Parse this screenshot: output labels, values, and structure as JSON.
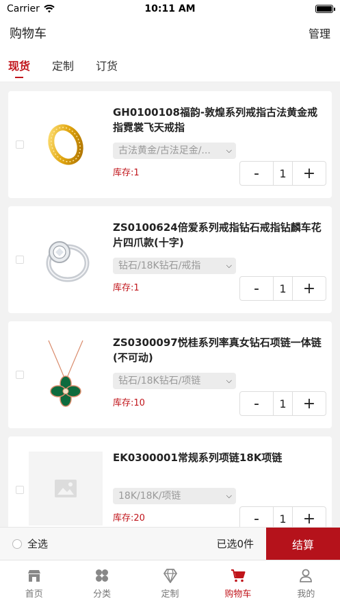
{
  "status_bar": {
    "carrier": "Carrier",
    "time": "10:11 AM"
  },
  "header": {
    "title": "购物车",
    "manage_label": "管理"
  },
  "tabs": [
    {
      "label": "现货",
      "active": true
    },
    {
      "label": "定制",
      "active": false
    },
    {
      "label": "订货",
      "active": false
    }
  ],
  "items": [
    {
      "name": "GH0100108福韵-敦煌系列戒指古法黄金戒指霓裳飞天戒指",
      "spec": "古法黄金/古法足金/...",
      "stock": "库存:1",
      "quantity": "1",
      "image": "gold-ring"
    },
    {
      "name": "ZS0100624倍爱系列戒指钻石戒指钻麟车花片四爪款(十字)",
      "spec": "钻石/18K钻石/戒指",
      "stock": "库存:1",
      "quantity": "1",
      "image": "diamond-ring"
    },
    {
      "name": "ZS0300097悦桂系列率真女钻石项链一体链(不可动)",
      "spec": "钻石/18K钻石/项链",
      "stock": "库存:10",
      "quantity": "1",
      "image": "malachite-necklace"
    },
    {
      "name": "EK0300001常规系列项链18K项链",
      "spec": "18K/18K/项链",
      "stock": "库存:20",
      "quantity": "1",
      "image": "placeholder"
    }
  ],
  "stepper": {
    "minus": "-",
    "plus": "+"
  },
  "checkout_bar": {
    "select_all_label": "全选",
    "selected_count": "已选0件",
    "checkout_label": "结算"
  },
  "tab_bar": [
    {
      "label": "首页",
      "icon": "store-icon",
      "active": false
    },
    {
      "label": "分类",
      "icon": "category-icon",
      "active": false
    },
    {
      "label": "定制",
      "icon": "diamond-icon",
      "active": false
    },
    {
      "label": "购物车",
      "icon": "cart-icon",
      "active": true
    },
    {
      "label": "我的",
      "icon": "user-icon",
      "active": false
    }
  ],
  "colors": {
    "accent": "#c0141a",
    "checkout": "#b5121b"
  }
}
